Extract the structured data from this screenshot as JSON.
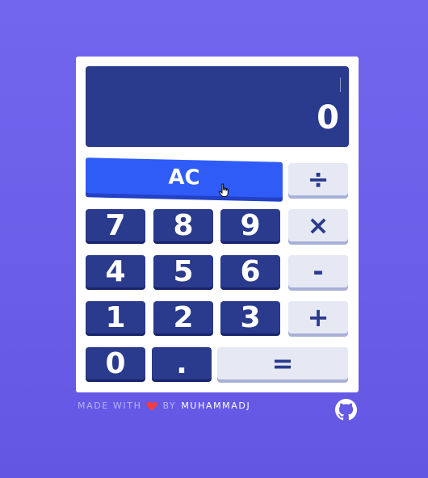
{
  "display": {
    "value": "0"
  },
  "keys": {
    "ac": "AC",
    "divide": "÷",
    "multiply": "×",
    "minus": "-",
    "plus": "+",
    "equals": "=",
    "dot": ".",
    "seven": "7",
    "eight": "8",
    "nine": "9",
    "four": "4",
    "five": "5",
    "six": "6",
    "one": "1",
    "two": "2",
    "three": "3",
    "zero": "0"
  },
  "footer": {
    "made_with": "MADE WITH",
    "by": "BY",
    "author": "MUHAMMADJ"
  },
  "icons": {
    "heart": "heart-icon",
    "github": "github-icon",
    "cursor": "hand-pointer-icon"
  },
  "colors": {
    "background": "#6a5ee8",
    "display": "#2a3a8d",
    "number_key": "#2a3a8d",
    "operator_key": "#e6e9f4",
    "clear_key": "#2f5cf7",
    "heart": "#ff3b3b"
  }
}
